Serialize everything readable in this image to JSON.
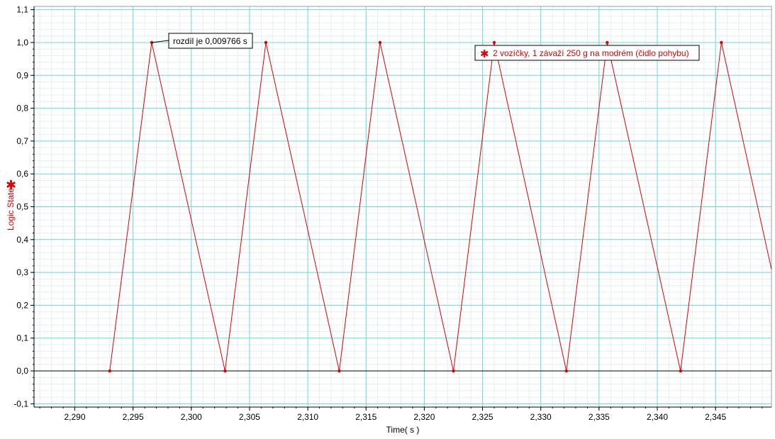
{
  "chart_data": {
    "type": "line",
    "xlabel": "Time( s )",
    "ylabel": "Logic State",
    "xlim": [
      2.2865,
      2.3498
    ],
    "ylim": [
      -0.11,
      1.11
    ],
    "x_ticks": [
      "2,290",
      "2,295",
      "2,300",
      "2,305",
      "2,310",
      "2,315",
      "2,320",
      "2,325",
      "2,330",
      "2,335",
      "2,340",
      "2,345"
    ],
    "x_tick_values": [
      2.29,
      2.295,
      2.3,
      2.305,
      2.31,
      2.315,
      2.32,
      2.325,
      2.33,
      2.335,
      2.34,
      2.345
    ],
    "y_ticks": [
      "-0,1",
      "0,0",
      "0,1",
      "0,2",
      "0,3",
      "0,4",
      "0,5",
      "0,6",
      "0,7",
      "0,8",
      "0,9",
      "1,0",
      "1,1"
    ],
    "y_tick_values": [
      -0.1,
      0.0,
      0.1,
      0.2,
      0.3,
      0.4,
      0.5,
      0.6,
      0.7,
      0.8,
      0.9,
      1.0,
      1.1
    ],
    "grid": true,
    "series": [
      {
        "name": "2 vozíčky, 1 závaží 250 g na modrém (čidlo pohybu)",
        "color": "#dd0000",
        "x": [
          2.293,
          2.2966,
          2.3029,
          2.3064,
          2.3127,
          2.3162,
          2.3225,
          2.326,
          2.3322,
          2.3357,
          2.342,
          2.3455,
          2.3498
        ],
        "y": [
          0,
          1,
          0,
          1,
          0,
          1,
          0,
          1,
          0,
          1,
          0,
          1,
          0.31
        ]
      }
    ],
    "annotations": [
      {
        "text": "rozdíl je 0,009766 s",
        "x": 2.2966,
        "y": 1.0
      }
    ],
    "legend": {
      "position": "top-right",
      "marker": "✱"
    }
  }
}
